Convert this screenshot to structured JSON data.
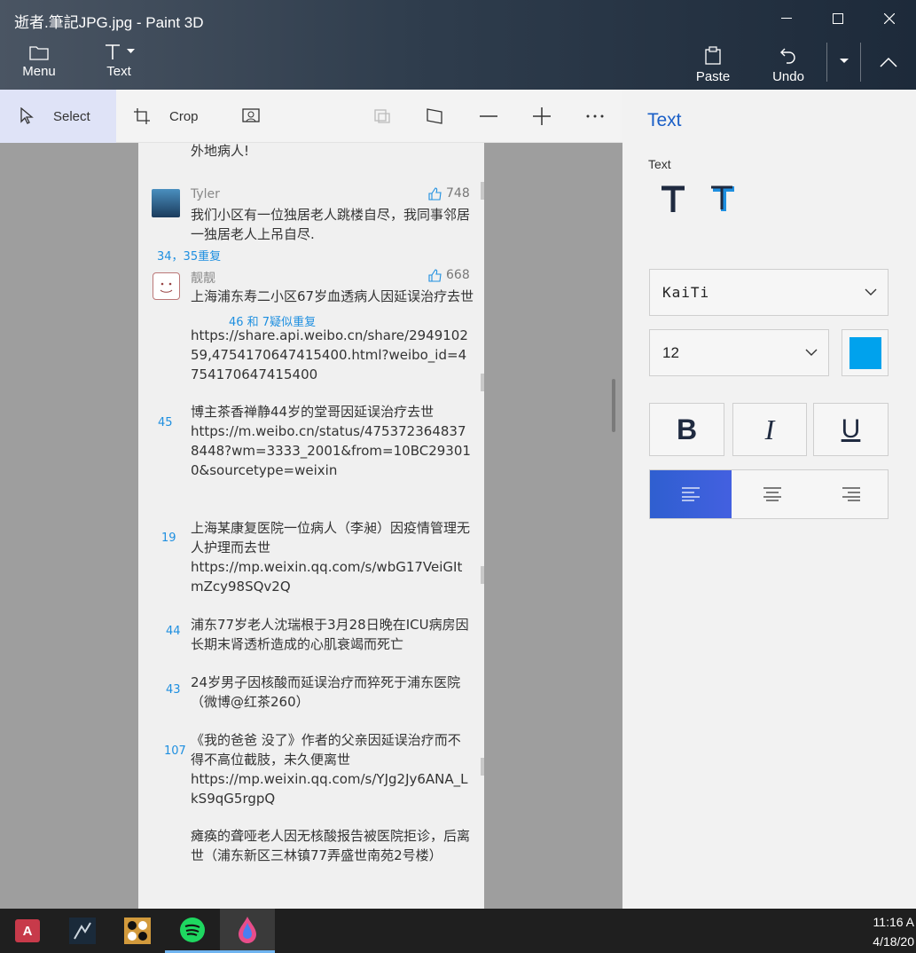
{
  "window": {
    "title": "逝者.筆記JPG.jpg - Paint 3D"
  },
  "commandbar": {
    "menu_label": "Menu",
    "text_label": "Text",
    "paste_label": "Paste",
    "undo_label": "Undo"
  },
  "toolbar": {
    "select_label": "Select",
    "crop_label": "Crop"
  },
  "image": {
    "posts": [
      {
        "text": "外地病人!"
      },
      {
        "user": "Tyler",
        "likes": "748",
        "text": "我们小区有一位独居老人跳楼自尽，我同事邻居一独居老人上吊自尽."
      },
      {
        "user": "靓靓",
        "likes": "668",
        "text": "上海浦东寿二小区67岁血透病人因延误治疗去世",
        "url": "https://share.api.weibo.cn/share/294910259,4754170647415400.html?weibo_id=4754170647415400"
      },
      {
        "text": "博主茶香禅静44岁的堂哥因延误治疗去世",
        "url": "https://m.weibo.cn/status/4753723648378448?wm=3333_2001&from=10BC293010&sourcetype=weixin"
      },
      {
        "text": "上海某康复医院一位病人（李昶）因疫情管理无人护理而去世",
        "url": "https://mp.weixin.qq.com/s/wbG17VeiGItmZcy98SQv2Q"
      },
      {
        "text": "浦东77岁老人沈瑞根于3月28日晚在ICU病房因长期末肾透析造成的心肌衰竭而死亡"
      },
      {
        "text": "24岁男子因核酸而延误治疗而猝死于浦东医院（微博@红茶260）"
      },
      {
        "text": "《我的爸爸 没了》作者的父亲因延误治疗而不得不高位截肢，未久便离世",
        "url": "https://mp.weixin.qq.com/s/YJg2Jy6ANA_LkS9qG5rgpQ"
      },
      {
        "text": "瘫痪的聋哑老人因无核酸报告被医院拒诊，后离世（浦东新区三林镇77弄盛世南苑2号楼）"
      }
    ],
    "annotations": {
      "a1": "34，35重复",
      "a2": "46 和 7疑似重复",
      "n45": "45",
      "n19": "19",
      "n44": "44",
      "n43": "43",
      "n107": "107"
    }
  },
  "panel": {
    "title": "Text",
    "text_label": "Text",
    "font": "KaiTi",
    "size": "12",
    "color": "#00a2ed",
    "bold_label": "B",
    "italic_label": "I",
    "underline_label": "U",
    "align": "left"
  },
  "taskbar": {
    "time": "11:16 A",
    "date": "4/18/20"
  }
}
